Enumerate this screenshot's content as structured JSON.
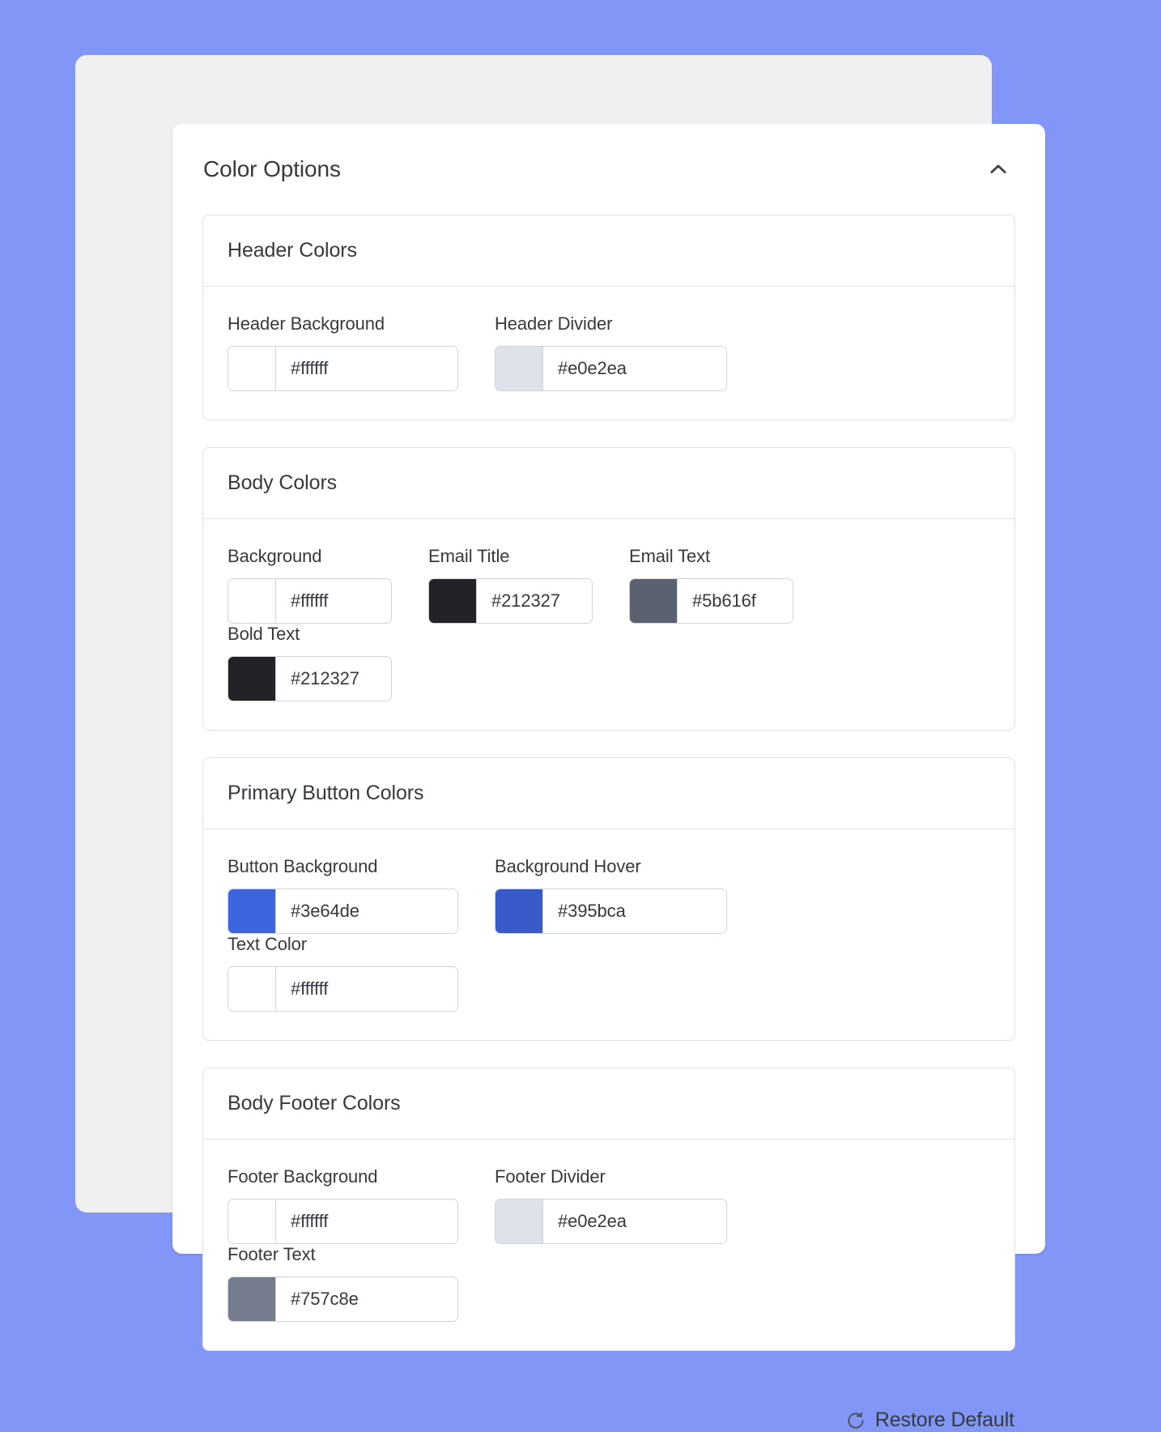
{
  "panel": {
    "title": "Color Options",
    "collapse_icon": "chevron-up-icon"
  },
  "sections": [
    {
      "id": "header-colors",
      "title": "Header Colors",
      "fields": [
        {
          "label": "Header Background",
          "value": "#ffffff",
          "swatch": "#ffffff"
        },
        {
          "label": "Header Divider",
          "value": "#e0e2ea",
          "swatch": "#e0e2ea"
        }
      ]
    },
    {
      "id": "body-colors",
      "title": "Body Colors",
      "fields": [
        {
          "label": "Background",
          "value": "#ffffff",
          "swatch": "#ffffff"
        },
        {
          "label": "Email Title",
          "value": "#212327",
          "swatch": "#212327"
        },
        {
          "label": "Email Text",
          "value": "#5b616f",
          "swatch": "#5b616f"
        },
        {
          "label": "Bold Text",
          "value": "#212327",
          "swatch": "#212327"
        }
      ]
    },
    {
      "id": "primary-button-colors",
      "title": "Primary Button Colors",
      "fields": [
        {
          "label": "Button Background",
          "value": "#3e64de",
          "swatch": "#3e64de"
        },
        {
          "label": "Background Hover",
          "value": "#395bca",
          "swatch": "#395bca"
        },
        {
          "label": "Text Color",
          "value": "#ffffff",
          "swatch": "#ffffff"
        }
      ]
    },
    {
      "id": "body-footer-colors",
      "title": "Body Footer Colors",
      "fields": [
        {
          "label": "Footer Background",
          "value": "#ffffff",
          "swatch": "#ffffff"
        },
        {
          "label": "Footer Divider",
          "value": "#e0e2ea",
          "swatch": "#e0e2ea"
        },
        {
          "label": "Footer Text",
          "value": "#757c8e",
          "swatch": "#757c8e"
        }
      ]
    }
  ],
  "footer": {
    "restore_label": "Restore Default",
    "restore_icon": "rotate-refresh-icon"
  },
  "theme": {
    "page_background": "#8296f8",
    "shell_background": "#f0f0f0",
    "card_background": "#ffffff",
    "border": "#dee2e6",
    "input_border": "#ced4da",
    "text": "#343a40"
  }
}
